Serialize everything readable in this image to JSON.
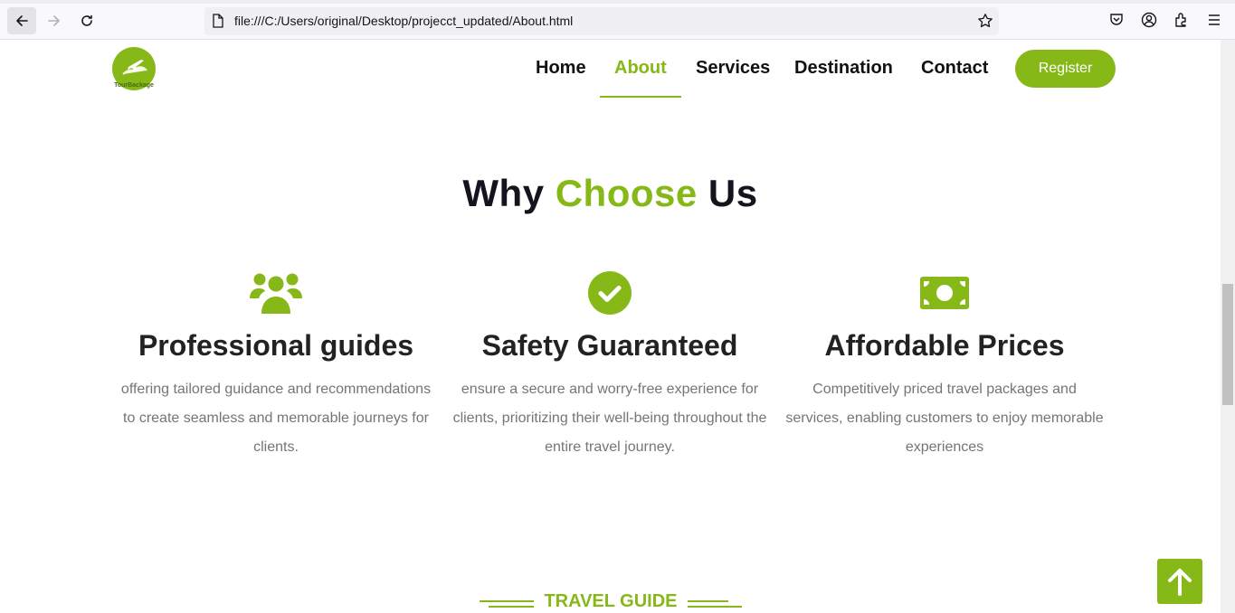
{
  "browser": {
    "url": "file:///C:/Users/original/Desktop/projecct_updated/About.html"
  },
  "header": {
    "logo_text": "TourBackage",
    "nav": [
      {
        "label": "Home",
        "active": false
      },
      {
        "label": "About",
        "active": true
      },
      {
        "label": "Services",
        "active": false
      },
      {
        "label": "Destination",
        "active": false
      },
      {
        "label": "Contact",
        "active": false
      }
    ],
    "register_label": "Register"
  },
  "why": {
    "title_part1": "Why ",
    "title_highlight": "Choose",
    "title_part2": " Us",
    "features": [
      {
        "icon": "users-icon",
        "title": "Professional guides",
        "text": "offering tailored guidance and recommendations to create seamless and memorable journeys for clients."
      },
      {
        "icon": "check-circle-icon",
        "title": "Safety Guaranteed",
        "text": "ensure a secure and worry-free experience for clients, prioritizing their well-being throughout the entire travel journey."
      },
      {
        "icon": "money-bill-icon",
        "title": "Affordable Prices",
        "text": "Competitively priced travel packages and services, enabling customers to enjoy memorable experiences"
      }
    ]
  },
  "travel_guide": {
    "label": "TRAVEL GUIDE"
  },
  "colors": {
    "accent": "#86b817",
    "heading": "#14141f",
    "body_text": "#757575"
  }
}
